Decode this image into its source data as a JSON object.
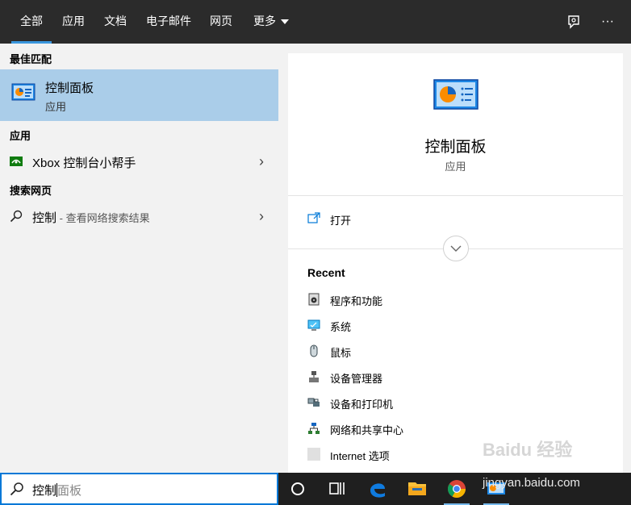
{
  "tabs": [
    {
      "label": "全部",
      "active": true
    },
    {
      "label": "应用"
    },
    {
      "label": "文档"
    },
    {
      "label": "电子邮件"
    },
    {
      "label": "网页"
    },
    {
      "label": "更多"
    }
  ],
  "top_icons": [
    "feedback-icon",
    "more-options-icon"
  ],
  "top_more_glyph": "···",
  "left": {
    "best_match_heading": "最佳匹配",
    "best_match": {
      "title": "控制面板",
      "subtitle": "应用",
      "icon": "control-panel-icon"
    },
    "apps_heading": "应用",
    "apps": [
      {
        "label": "Xbox 控制台小帮手",
        "icon": "xbox-icon"
      }
    ],
    "web_heading": "搜索网页",
    "web": [
      {
        "label": "控制",
        "hint": " - 查看网络搜索结果",
        "icon": "search-icon"
      }
    ]
  },
  "right": {
    "title": "控制面板",
    "subtitle": "应用",
    "open_label": "打开",
    "recent_heading": "Recent",
    "recent": [
      {
        "label": "程序和功能",
        "icon": "programs-icon"
      },
      {
        "label": "系统",
        "icon": "system-icon"
      },
      {
        "label": "鼠标",
        "icon": "mouse-icon"
      },
      {
        "label": "设备管理器",
        "icon": "device-manager-icon"
      },
      {
        "label": "设备和打印机",
        "icon": "printer-icon"
      },
      {
        "label": "网络和共享中心",
        "icon": "network-icon"
      },
      {
        "label": "Internet 选项",
        "icon": "internet-options-icon"
      }
    ]
  },
  "search": {
    "typed": "控制",
    "suggestion": "面板"
  },
  "taskbar": [
    "cortana-icon",
    "task-view-icon",
    "edge-icon",
    "file-explorer-icon",
    "chrome-icon",
    "control-panel-app-icon"
  ],
  "watermark": {
    "text": "Baidu 经验",
    "url": "jingyan.baidu.com"
  },
  "colors": {
    "accent": "#0078d7",
    "selection": "#aacde9",
    "tabbar": "#2b2b2b",
    "pane": "#f2f2f2"
  }
}
